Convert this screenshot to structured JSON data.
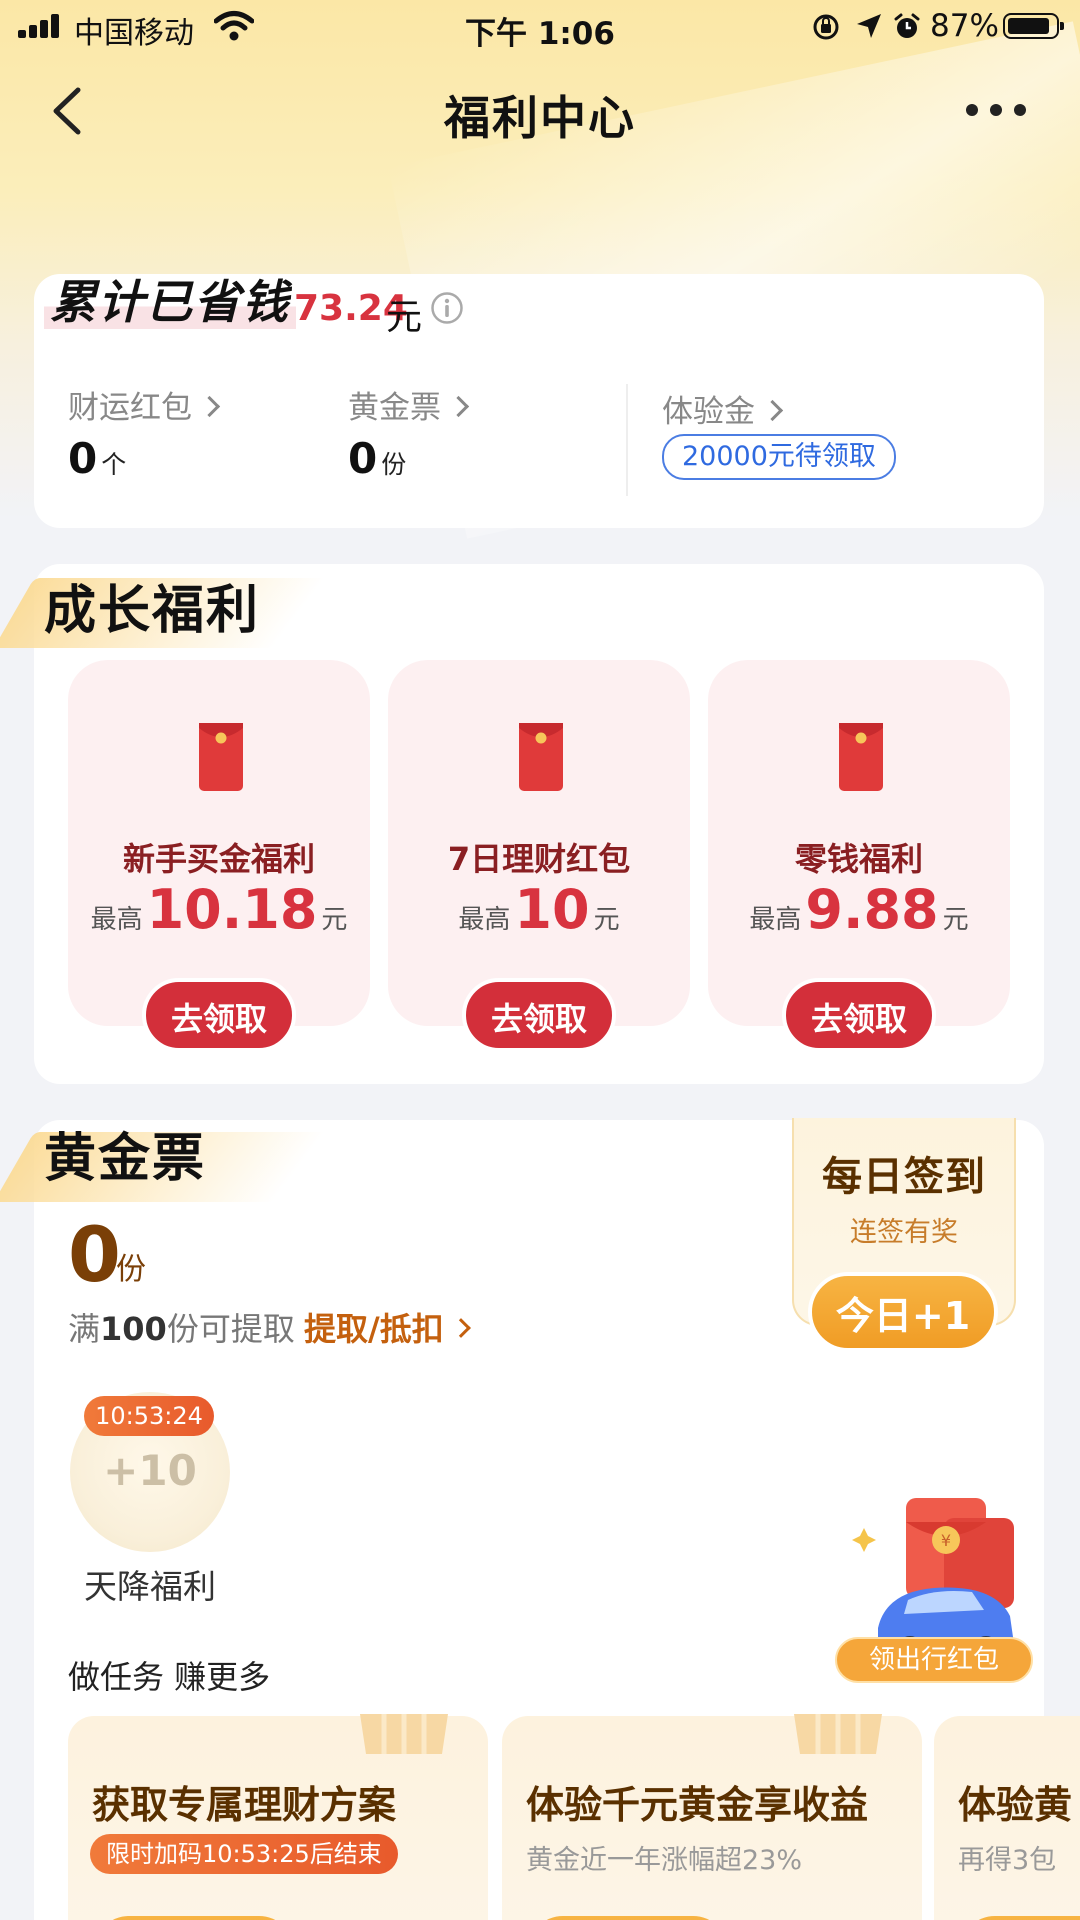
{
  "status_bar": {
    "carrier": "中国移动",
    "time": "下午 1:06",
    "battery": "87%"
  },
  "nav": {
    "title": "福利中心"
  },
  "summary": {
    "tag": "累计已省钱",
    "amount": "73.24",
    "unit": "元",
    "stats": [
      {
        "label": "财运红包",
        "value": "0",
        "unit": "个"
      },
      {
        "label": "黄金票",
        "value": "0",
        "unit": "份"
      },
      {
        "label": "体验金",
        "badge": "20000元待领取"
      }
    ]
  },
  "growth": {
    "title": "成长福利",
    "items": [
      {
        "title": "新手买金福利",
        "prefix": "最高",
        "value": "10.18",
        "unit": "元",
        "button": "去领取"
      },
      {
        "title": "7日理财红包",
        "prefix": "最高",
        "value": "10",
        "unit": "元",
        "button": "去领取"
      },
      {
        "title": "零钱福利",
        "prefix": "最高",
        "value": "9.88",
        "unit": "元",
        "button": "去领取"
      }
    ]
  },
  "gold_ticket": {
    "title": "黄金票",
    "count": "0",
    "count_unit": "份",
    "rule_prefix": "满",
    "rule_number": "100",
    "rule_suffix": "份可提取",
    "link": "提取/抵扣",
    "checkin": {
      "title": "每日签到",
      "subtitle": "连签有奖",
      "button": "今日+1"
    },
    "bubble": {
      "countdown": "10:53:24",
      "value": "+10",
      "label": "天降福利"
    },
    "promo_label": "领出行红包",
    "tasks_title": "做任务 赚更多",
    "tasks": [
      {
        "title": "获取专属理财方案",
        "badge": "限时加码10:53:25后结束"
      },
      {
        "title": "体验千元黄金享收益",
        "subtitle": "黄金近一年涨幅超23%"
      },
      {
        "title": "体验黄",
        "subtitle": "再得3包"
      }
    ]
  },
  "colors": {
    "accent_red": "#d32f3a",
    "gold_brown": "#7a3f07",
    "orange": "#f09c25",
    "blue": "#2f6ae0"
  }
}
